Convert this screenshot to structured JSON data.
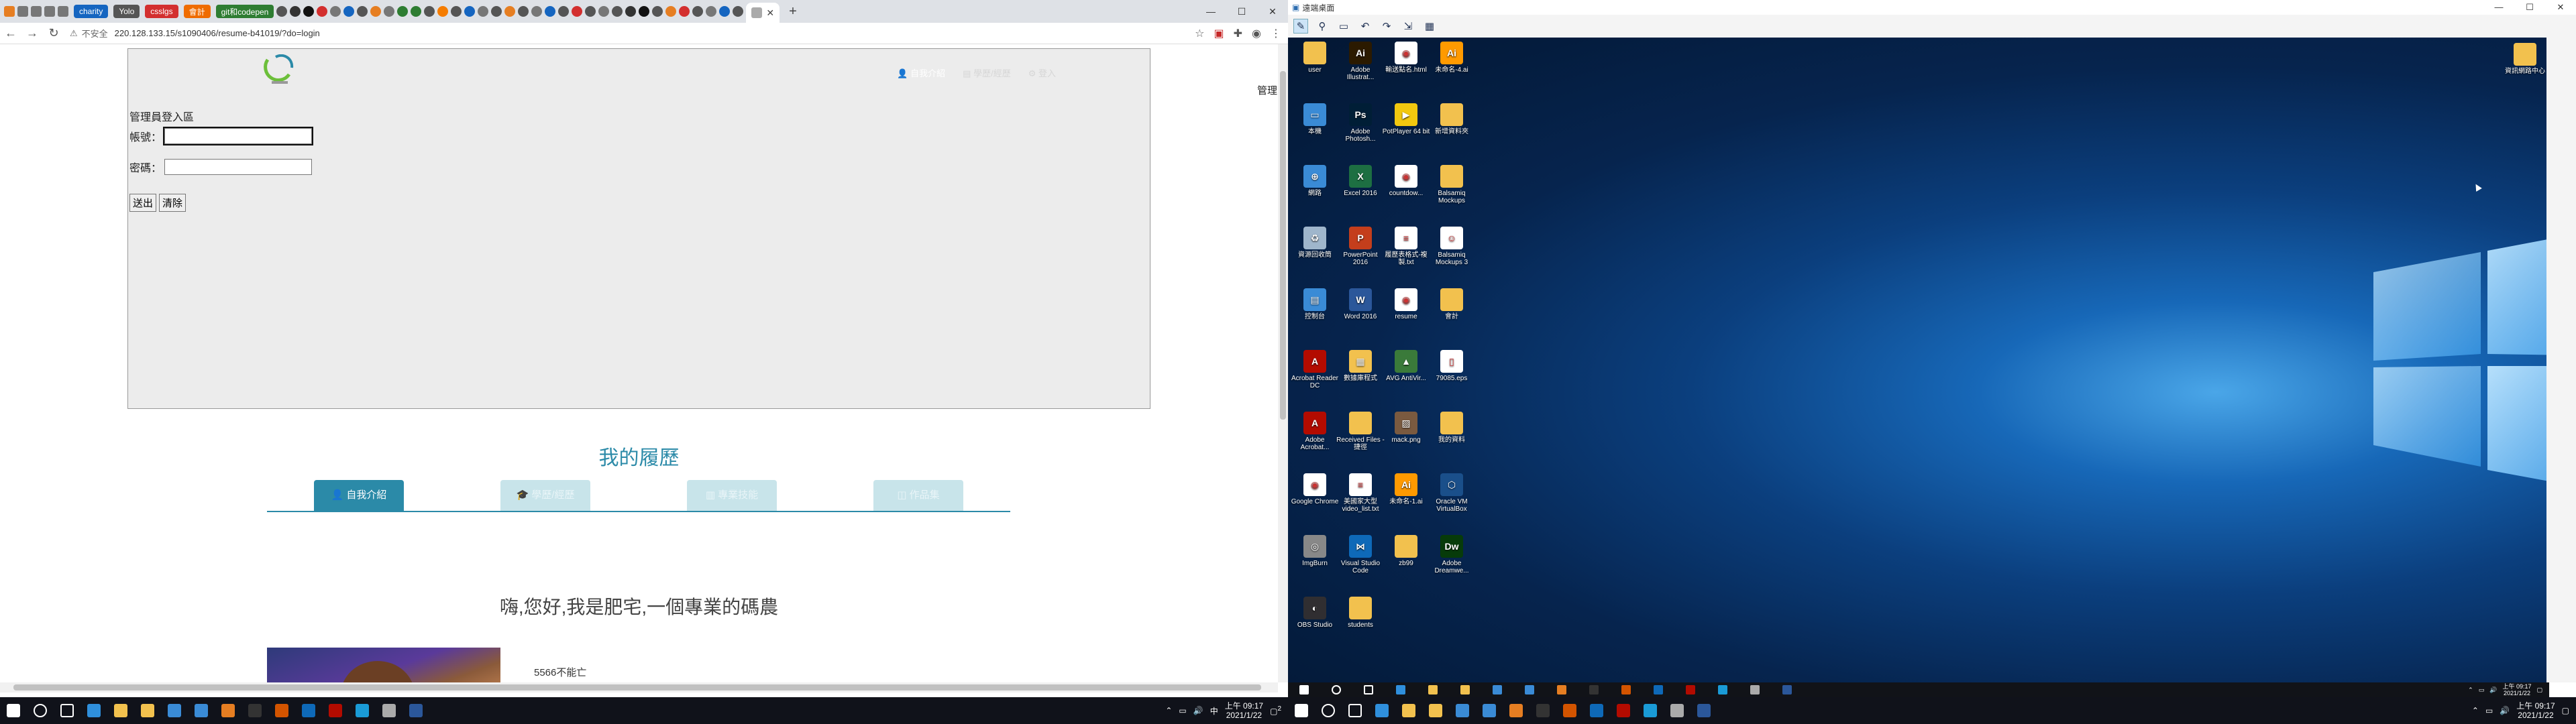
{
  "browser": {
    "tabs_named": [
      {
        "label": "charity",
        "color": "#1565c0"
      },
      {
        "label": "Yolo",
        "color": "#555555"
      },
      {
        "label": "csslgs",
        "color": "#d32f2f"
      },
      {
        "label": "會計",
        "color": "#ef6c00"
      },
      {
        "label": "git和codepen",
        "color": "#2e7d32"
      }
    ],
    "active_tab_close": "✕",
    "new_tab": "+",
    "url_security": "不安全",
    "url": "220.128.133.15/s1090406/resume-b41019/?do=login",
    "window_controls": {
      "min": "—",
      "max": "☐",
      "close": "✕"
    }
  },
  "page": {
    "topnav": [
      {
        "label": "自我介紹",
        "icon": "user-icon"
      },
      {
        "label": "學歷/經歷",
        "icon": "graduation-icon"
      },
      {
        "label": "登入",
        "icon": "login-icon"
      }
    ],
    "admin_title": "管理員登入區",
    "account_label": "帳號：",
    "password_label": "密碼：",
    "submit_label": "送出",
    "clear_label": "清除",
    "side_label": "管理",
    "resume_title": "我的履歷",
    "resume_tabs": [
      {
        "label": "自我介紹",
        "active": true
      },
      {
        "label": "學歷/經歷",
        "active": false
      },
      {
        "label": "專業技能",
        "active": false
      },
      {
        "label": "作品集",
        "active": false
      }
    ],
    "greeting": "嗨,您好,我是肥宅,一個專業的碼農",
    "caption": "5566不能亡"
  },
  "taskbar_left": {
    "icons": [
      "windows-icon",
      "search-icon",
      "task-view-icon",
      "edge-icon",
      "chrome-icon",
      "explorer-icon",
      "store-icon",
      "mail-icon",
      "app-icon",
      "terminal-icon",
      "snip-icon",
      "vscode-icon",
      "filezilla-icon",
      "app2-icon",
      "settings-icon",
      "word-icon"
    ],
    "time": "上午 09:17",
    "date": "2021/1/22",
    "notification_count": "2"
  },
  "remote": {
    "title": "遠端桌面",
    "desktop_icons": [
      {
        "label": "user",
        "color": "#f2c14e",
        "glyph": ""
      },
      {
        "label": "Adobe Illustrat...",
        "color": "#2b1a00",
        "glyph": "Ai"
      },
      {
        "label": "輸送點名.html",
        "color": "#ffffff",
        "glyph": "◉"
      },
      {
        "label": "未命名-4.ai",
        "color": "#ff9a00",
        "glyph": "Ai"
      },
      {
        "label": "本機",
        "color": "#3a8bd6",
        "glyph": "▭"
      },
      {
        "label": "Adobe Photosh...",
        "color": "#001e36",
        "glyph": "Ps"
      },
      {
        "label": "PotPlayer 64 bit",
        "color": "#f2c80f",
        "glyph": "▶"
      },
      {
        "label": "新增資料夾",
        "color": "#f2c14e",
        "glyph": ""
      },
      {
        "label": "網路",
        "color": "#3a8bd6",
        "glyph": "⊕"
      },
      {
        "label": "Excel 2016",
        "color": "#1d6f42",
        "glyph": "X"
      },
      {
        "label": "countdow...",
        "color": "#ffffff",
        "glyph": "◉"
      },
      {
        "label": "Balsamiq Mockups",
        "color": "#f2c14e",
        "glyph": ""
      },
      {
        "label": "資源回收筒",
        "color": "#9fb6cc",
        "glyph": "♻"
      },
      {
        "label": "PowerPoint 2016",
        "color": "#c43e1c",
        "glyph": "P"
      },
      {
        "label": "履歷表格式-複製.txt",
        "color": "#ffffff",
        "glyph": "≡"
      },
      {
        "label": "Balsamiq Mockups 3",
        "color": "#ffffff",
        "glyph": "☺"
      },
      {
        "label": "控制台",
        "color": "#3a8bd6",
        "glyph": "▤"
      },
      {
        "label": "Word 2016",
        "color": "#2b579a",
        "glyph": "W"
      },
      {
        "label": "resume",
        "color": "#ffffff",
        "glyph": "◉"
      },
      {
        "label": "會計",
        "color": "#f2c14e",
        "glyph": ""
      },
      {
        "label": "Acrobat Reader DC",
        "color": "#b30b00",
        "glyph": "A"
      },
      {
        "label": "數據庫程式",
        "color": "#f2c14e",
        "glyph": "▦"
      },
      {
        "label": "AVG AntiVir...",
        "color": "#3a7a3a",
        "glyph": "▲"
      },
      {
        "label": "79085.eps",
        "color": "#ffffff",
        "glyph": "▯"
      },
      {
        "label": "Adobe Acrobat...",
        "color": "#b30b00",
        "glyph": "A"
      },
      {
        "label": "Received Files - 捷徑",
        "color": "#f2c14e",
        "glyph": ""
      },
      {
        "label": "mack.png",
        "color": "#7a5a40",
        "glyph": "▨"
      },
      {
        "label": "我的資料",
        "color": "#f2c14e",
        "glyph": ""
      },
      {
        "label": "Google Chrome",
        "color": "#ffffff",
        "glyph": "◉"
      },
      {
        "label": "美國家大型 video_list.txt",
        "color": "#ffffff",
        "glyph": "≡"
      },
      {
        "label": "未命名-1.ai",
        "color": "#ff9a00",
        "glyph": "Ai"
      },
      {
        "label": "Oracle VM VirtualBox",
        "color": "#1a4f8a",
        "glyph": "⬡"
      },
      {
        "label": "ImgBurn",
        "color": "#888888",
        "glyph": "◎"
      },
      {
        "label": "Visual Studio Code",
        "color": "#0e69b8",
        "glyph": "⋈"
      },
      {
        "label": "zb99",
        "color": "#f2c14e",
        "glyph": ""
      },
      {
        "label": "Adobe Dreamwe...",
        "color": "#073b0a",
        "glyph": "Dw"
      },
      {
        "label": "OBS Studio",
        "color": "#302e31",
        "glyph": "◐"
      },
      {
        "label": "students",
        "color": "#f2c14e",
        "glyph": ""
      }
    ],
    "corner_folder": {
      "label": "資訊網路中心",
      "color": "#f2c14e"
    },
    "taskbar_icons": [
      "windows-icon",
      "search-icon",
      "task-view-icon",
      "edge-icon",
      "chrome-icon",
      "explorer-icon",
      "store-icon",
      "mail-icon",
      "app-icon",
      "terminal-icon",
      "snip-icon",
      "vscode-icon",
      "filezilla-icon",
      "app2-icon",
      "settings-icon",
      "word-icon"
    ],
    "time": "上午 09:17",
    "date": "2021/1/22"
  }
}
